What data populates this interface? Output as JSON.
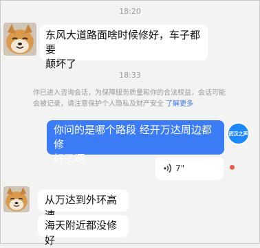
{
  "timestamps": [
    "18:20",
    "18:33"
  ],
  "messages": {
    "m1": "东风大道路面啥时候修好，车子都要颠坏了",
    "m1_line1": "东风大道路面啥时候修好，车子都要",
    "m1_line2": "颠坏了",
    "m2_line1": "你问的是哪个路段 经开万达周边都修",
    "m2_line2": "好了啊",
    "m3": "从万达到外环高速",
    "m4": "海天附近都没修好"
  },
  "system_note": {
    "text": "你已进入咨询会话，为保障服务质量和你的合法权益，会话可能会被记录，请注意保护个人隐私及财产安全",
    "link": "了解更多"
  },
  "voice_message": {
    "duration": "7\""
  },
  "bot_avatar": {
    "label": "武汉之声"
  },
  "colors": {
    "accent": "#3b7cf6",
    "background": "#f3f3f3",
    "unread": "#f05a4a"
  },
  "icons": {
    "voice": "sound-wave-icon",
    "user_avatar": "shiba-dog-avatar"
  }
}
